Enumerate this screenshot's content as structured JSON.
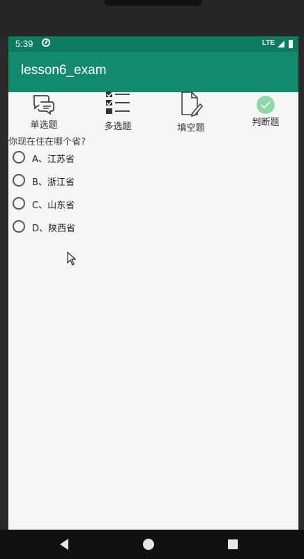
{
  "status_bar": {
    "time": "5:39",
    "network": "LTE"
  },
  "app_bar": {
    "title": "lesson6_exam"
  },
  "tabs": [
    {
      "label": "单选题",
      "icon": "chat-bubbles-icon"
    },
    {
      "label": "多选题",
      "icon": "checklist-icon"
    },
    {
      "label": "填空题",
      "icon": "document-edit-icon"
    },
    {
      "label": "判断题",
      "icon": "check-circle-icon"
    }
  ],
  "question": {
    "text": "你现在住在哪个省?"
  },
  "options": [
    {
      "label": "A、江苏省"
    },
    {
      "label": "B、浙江省"
    },
    {
      "label": "C、山东省"
    },
    {
      "label": "D、陕西省"
    }
  ],
  "colors": {
    "status_bar": "#0d7a60",
    "app_bar": "#138a6e",
    "check_icon": "#8fd8a8"
  }
}
